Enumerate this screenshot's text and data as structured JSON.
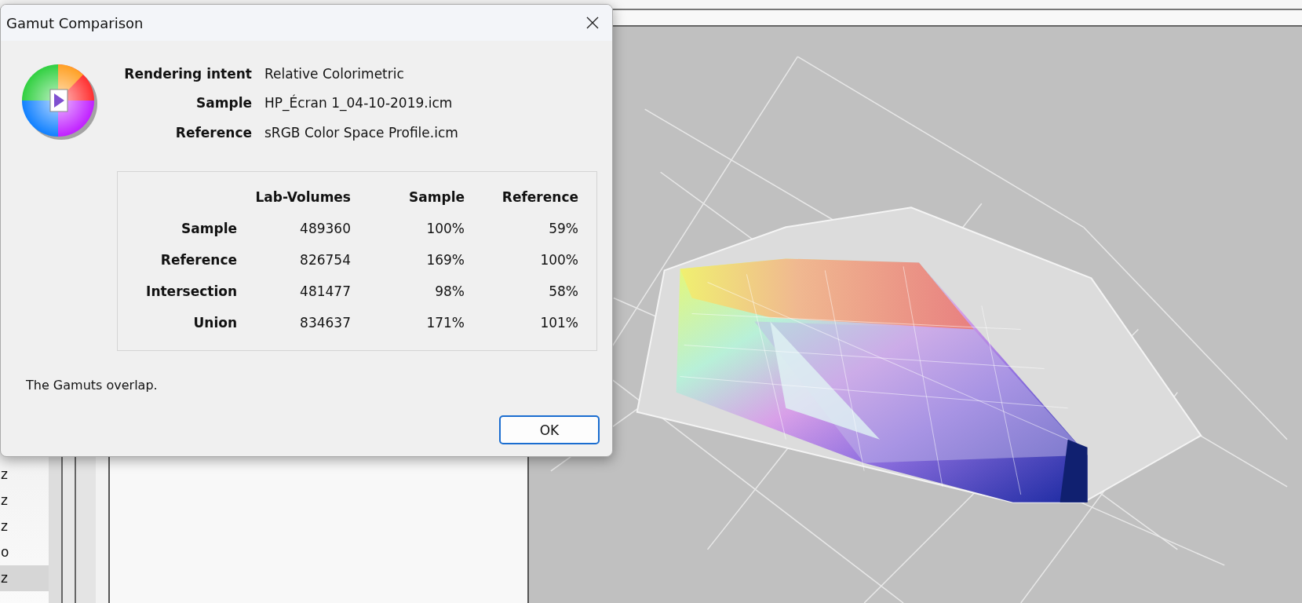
{
  "background": {
    "list_items": [
      {
        "text": "z",
        "selected": false
      },
      {
        "text": "z",
        "selected": false
      },
      {
        "text": "z",
        "selected": false
      },
      {
        "text": "o",
        "selected": false
      },
      {
        "text": "z",
        "selected": true
      }
    ]
  },
  "dialog": {
    "title": "Gamut Comparison",
    "fields": [
      {
        "label": "Rendering intent",
        "value": "Relative Colorimetric"
      },
      {
        "label": "Sample",
        "value": "HP_Écran 1_04-10-2019.icm"
      },
      {
        "label": "Reference",
        "value": "sRGB Color Space Profile.icm"
      }
    ],
    "table": {
      "columns": [
        "Lab-Volumes",
        "Sample",
        "Reference"
      ],
      "rows": [
        {
          "label": "Sample",
          "cells": [
            "489360",
            "100%",
            "59%"
          ]
        },
        {
          "label": "Reference",
          "cells": [
            "826754",
            "169%",
            "100%"
          ]
        },
        {
          "label": "Intersection",
          "cells": [
            "481477",
            "98%",
            "58%"
          ]
        },
        {
          "label": "Union",
          "cells": [
            "834637",
            "171%",
            "101%"
          ]
        }
      ]
    },
    "message": "The Gamuts overlap.",
    "buttons": [
      {
        "label": "OK",
        "default": true
      }
    ]
  }
}
